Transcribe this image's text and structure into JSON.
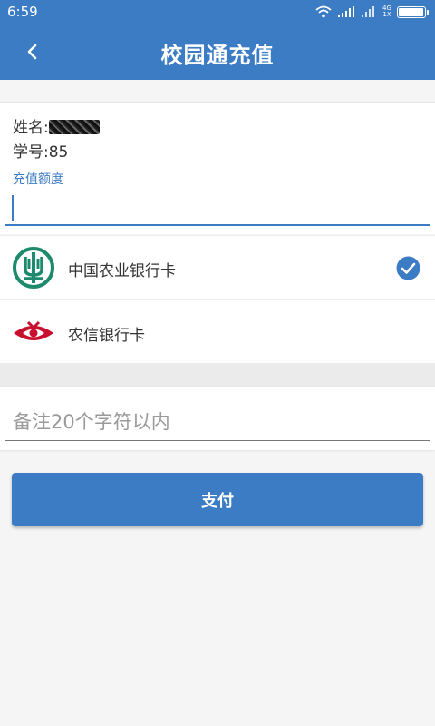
{
  "status_bar": {
    "time": "6:59",
    "network_label_top": "4G",
    "network_label_bottom": "1X",
    "battery_level": 0.95
  },
  "app_bar": {
    "title": "校园通充值",
    "back_icon": "chevron-left-icon"
  },
  "student": {
    "name_label": "姓名:",
    "id_text": "学号:85"
  },
  "amount": {
    "label": "充值额度",
    "value": ""
  },
  "payment_methods": [
    {
      "label": "中国农业银行卡",
      "icon": "abc-bank-logo",
      "selected": true
    },
    {
      "label": "农信银行卡",
      "icon": "rural-credit-bank-logo",
      "selected": false
    }
  ],
  "remark": {
    "placeholder": "备注20个字符以内"
  },
  "pay_button": {
    "label": "支付"
  },
  "colors": {
    "primary": "#3c7cc4",
    "abc_green": "#1d8a6e",
    "rcc_red": "#c8102e",
    "background": "#f5f5f5"
  }
}
